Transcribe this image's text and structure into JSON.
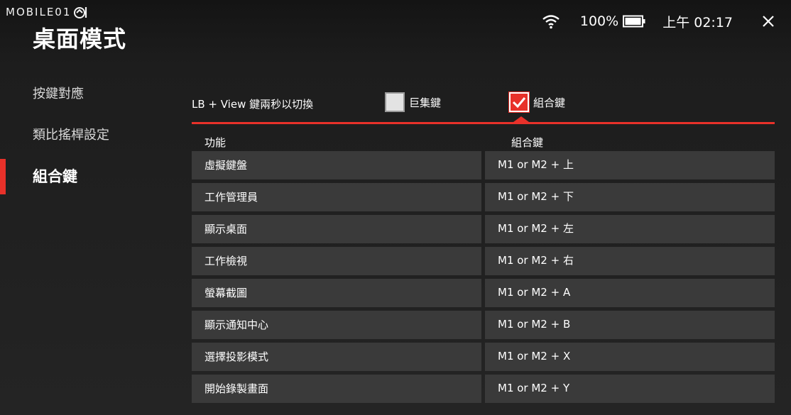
{
  "watermark": {
    "text": "MOBILE01"
  },
  "header": {
    "title": "桌面模式"
  },
  "status": {
    "battery": "100%",
    "time": "上午 02:17"
  },
  "sidebar": {
    "items": [
      {
        "label": "按鍵對應",
        "active": false
      },
      {
        "label": "類比搖桿設定",
        "active": false
      },
      {
        "label": "組合鍵",
        "active": true
      }
    ]
  },
  "toggle": {
    "label": "LB + View 鍵兩秒以切換",
    "options": [
      {
        "label": "巨集鍵",
        "checked": false
      },
      {
        "label": "組合鍵",
        "checked": true
      }
    ]
  },
  "table": {
    "headers": [
      "功能",
      "組合鍵"
    ],
    "rows": [
      {
        "function": "虛擬鍵盤",
        "combo": "M1 or M2 + 上"
      },
      {
        "function": "工作管理員",
        "combo": "M1 or M2 + 下"
      },
      {
        "function": "顯示桌面",
        "combo": "M1 or M2 + 左"
      },
      {
        "function": "工作檢視",
        "combo": "M1 or M2 + 右"
      },
      {
        "function": "螢幕截圖",
        "combo": "M1 or M2 + A"
      },
      {
        "function": "顯示通知中心",
        "combo": "M1 or M2 + B"
      },
      {
        "function": "選擇投影模式",
        "combo": "M1 or M2 + X"
      },
      {
        "function": "開始錄製畫面",
        "combo": "M1 or M2 + Y"
      }
    ]
  },
  "colors": {
    "accent": "#e8312a",
    "background": "#202020",
    "cell": "#3a3a3a"
  },
  "icons": [
    "wifi-icon",
    "battery-icon",
    "close-icon",
    "checkmark-icon",
    "mobile01-logo-icon"
  ]
}
